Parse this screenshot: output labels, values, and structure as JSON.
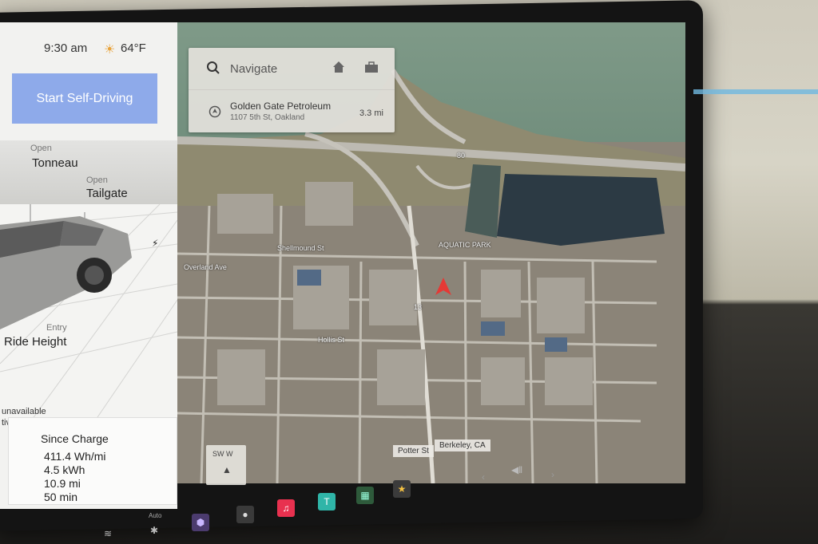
{
  "status": {
    "time": "9:30 am",
    "temperature": "64°F"
  },
  "vehicle": {
    "self_driving_label": "Start Self-Driving",
    "tonneau": {
      "state": "Open",
      "label": "Tonneau"
    },
    "tailgate": {
      "state": "Open",
      "label": "Tailgate"
    },
    "ride_height": {
      "state": "Entry",
      "label": "Ride Height"
    },
    "unavailable_text": "unavailable",
    "partial_text": "tive"
  },
  "trip": {
    "title": "Since Charge",
    "efficiency": "411.4 Wh/mi",
    "energy": "4.5 kWh",
    "distance": "10.9 mi",
    "duration": "50 min"
  },
  "navigation": {
    "search_placeholder": "Navigate",
    "suggestion": {
      "name": "Golden Gate Petroleum",
      "address": "1107 5th St, Oakland",
      "distance": "3.3 mi"
    }
  },
  "map": {
    "streets": {
      "shellmound": "Shellmound St",
      "overland": "Overland Ave",
      "hollis": "Hollis St",
      "aquatic": "AQUATIC PARK",
      "route": "13",
      "interstate": "80"
    },
    "location_street": "Potter St",
    "location_city": "Berkeley, CA",
    "compass_heading": "SW W"
  },
  "dock": {
    "auto_label": "Auto"
  },
  "colors": {
    "accent": "#8eaaea",
    "route_arrow": "#e53935"
  }
}
